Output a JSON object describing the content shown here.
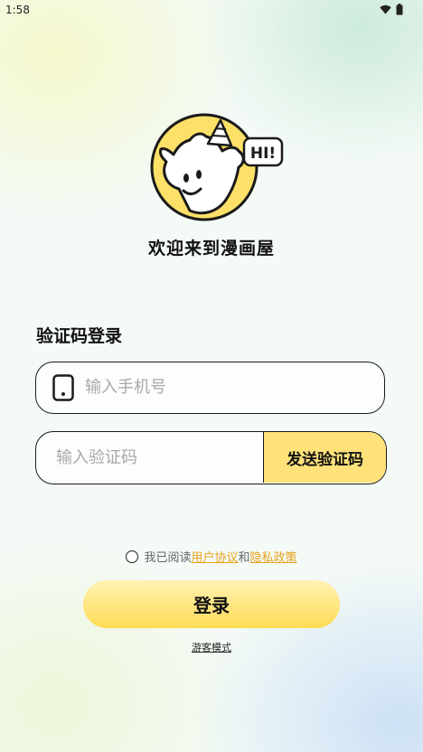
{
  "status_bar": {
    "time": "1:58",
    "icons": [
      "wifi-icon",
      "battery-icon"
    ]
  },
  "logo": {
    "badge_text": "HI!"
  },
  "welcome": "欢迎来到漫画屋",
  "form": {
    "title": "验证码登录",
    "phone_placeholder": "输入手机号",
    "phone_value": "",
    "code_placeholder": "输入验证码",
    "code_value": "",
    "send_code_label": "发送验证码"
  },
  "agreement": {
    "prefix": "我已阅读",
    "user_agreement": "用户协议",
    "conjunction": "和",
    "privacy_policy": "隐私政策",
    "checked": false
  },
  "login_label": "登录",
  "guest_label": "游客模式",
  "colors": {
    "accent_yellow": "#ffdc55",
    "link_orange": "#e8a21c",
    "mascot_bg": "#fde068",
    "border": "#1a1a1a"
  }
}
